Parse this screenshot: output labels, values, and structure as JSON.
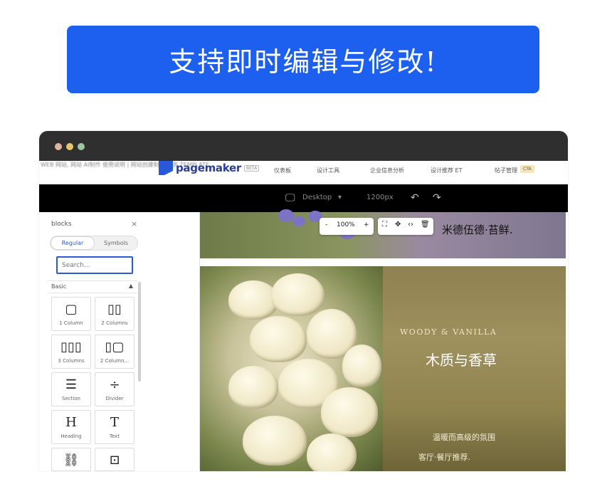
{
  "banner": {
    "text": "支持即时编辑与修改!"
  },
  "window": {
    "traffic_lights": [
      "#e0b3a2",
      "#e8c66a",
      "#9fc4a0"
    ]
  },
  "topnav": {
    "blurred_text": "WEB 网站, 网站 AI制作 使用说明 | 网站创建制作 服务 TEMPLATE",
    "logo_text": "pagemaker",
    "beta_label": "BETA",
    "items": [
      "仪表板",
      "设计工具",
      "企业信息分析",
      "设计推荐 ET",
      "帖子管理"
    ],
    "cta_label": "CTA"
  },
  "toolbar": {
    "device_label": "Desktop",
    "device_caret": "▾",
    "width_label": "1200px",
    "undo_icon": "↶",
    "redo_icon": "↷"
  },
  "panel": {
    "title": "blocks",
    "close_icon": "×",
    "tabs": [
      {
        "label": "Regular",
        "active": true
      },
      {
        "label": "Symbols",
        "active": false
      }
    ],
    "search_placeholder": "Search...",
    "section_label": "Basic",
    "section_caret": "▲",
    "blocks": [
      {
        "icon": "▢",
        "label": "1 Column"
      },
      {
        "icon": "▯▯",
        "label": "2 Columns"
      },
      {
        "icon": "▯▯▯",
        "label": "3 Columns"
      },
      {
        "icon": "▯▢",
        "label": "2 Column..."
      },
      {
        "icon": "☰",
        "label": "Section"
      },
      {
        "icon": "÷",
        "label": "Divider"
      },
      {
        "icon": "H",
        "label": "Heading"
      },
      {
        "icon": "T",
        "label": "Text"
      },
      {
        "icon": "⛓",
        "label": ""
      },
      {
        "icon": "⊡",
        "label": ""
      }
    ]
  },
  "canvas": {
    "zoom": {
      "minus": "-",
      "value": "100%",
      "plus": "+"
    },
    "edit_tools": [
      "⛶",
      "✥",
      "‹›",
      "🗑"
    ],
    "top_title": "米德伍德·苔鲜.",
    "en_title": "WOODY & VANILLA",
    "cn_title": "木质与香草",
    "desc_line1": "温暖而高级的氛围",
    "desc_line2": "客厅·餐厅推荐."
  }
}
